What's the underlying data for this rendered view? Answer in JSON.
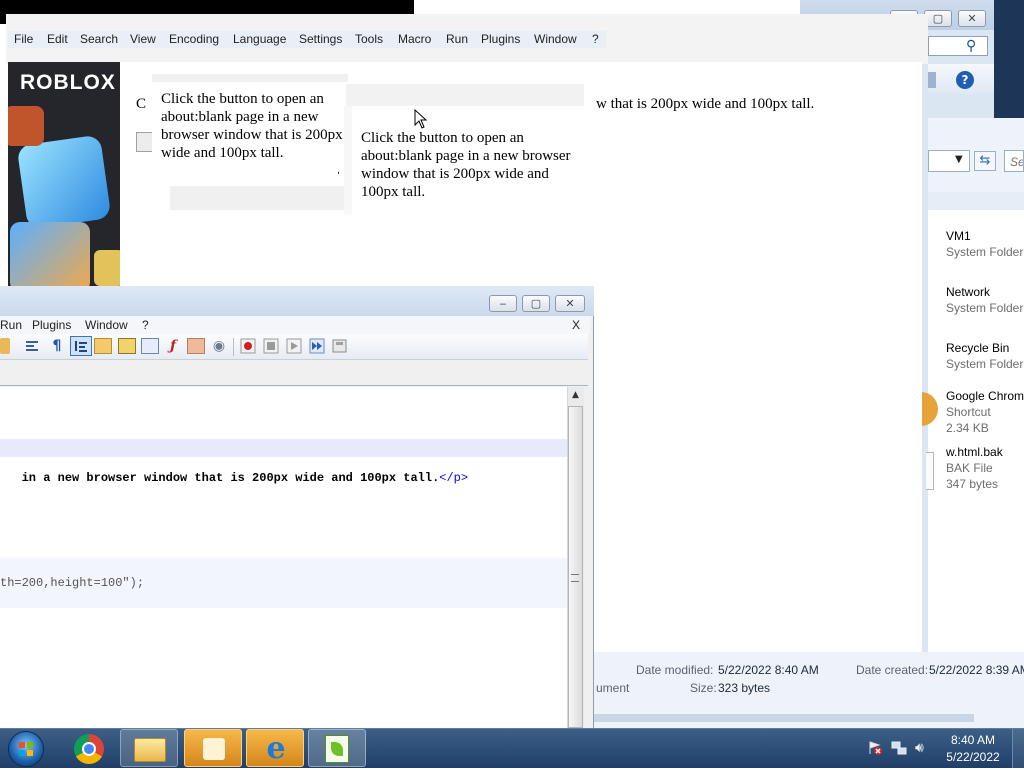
{
  "npp_top": {
    "menu": [
      "File",
      "Edit",
      "Search",
      "View",
      "Encoding",
      "Language",
      "Settings",
      "Tools",
      "Macro",
      "Run",
      "Plugins",
      "Window",
      "?"
    ]
  },
  "browser": {
    "line_fragment_left": "C",
    "line_fragment_right": "w that is 200px wide and 100px tall.",
    "popup1_text": "Click the button to open an about:blank page in a new browser window that is 200px wide and 100px tall.",
    "popup2_text": "Click the button to open an about:blank page in a new browser window that is 200px wide and 100px tall.",
    "roblox_logo": "ROBLOX"
  },
  "npp_front": {
    "menu": [
      "Run",
      "Plugins",
      "Window",
      "?"
    ],
    "close_doc": "X",
    "code_line1": " in a new browser window that is 200px wide and 100px tall.",
    "code_line1_tag": "</p>",
    "code_line2": "th=200,height=100\");"
  },
  "explorer": {
    "search_placeholder": "Se",
    "items": [
      {
        "name": "VM1",
        "type": "System Folder",
        "size": ""
      },
      {
        "name": "Network",
        "type": "System Folder",
        "size": ""
      },
      {
        "name": "Recycle Bin",
        "type": "System Folder",
        "size": ""
      },
      {
        "name": "Google Chrom",
        "type": "Shortcut",
        "size": "2.34 KB"
      },
      {
        "name": "w.html.bak",
        "type": "BAK File",
        "size": "347 bytes"
      }
    ],
    "details": {
      "modified_label": "Date modified:",
      "modified_value": "5/22/2022 8:40 AM",
      "created_label": "Date created:",
      "created_value": "5/22/2022 8:39 AM",
      "type_fragment": "ument",
      "size_label": "Size:",
      "size_value": "323 bytes"
    }
  },
  "taskbar": {
    "time": "8:40 AM",
    "date": "5/22/2022",
    "apps": [
      "start-orb",
      "chrome",
      "file-explorer",
      "media-player",
      "internet-explorer",
      "notepad-plus-plus"
    ]
  },
  "colors": {
    "taskbar": "#1f3f68",
    "titlebar": "#dce7f3",
    "code_tag": "#0000ff",
    "line_highlight": "#e8e8ff"
  }
}
